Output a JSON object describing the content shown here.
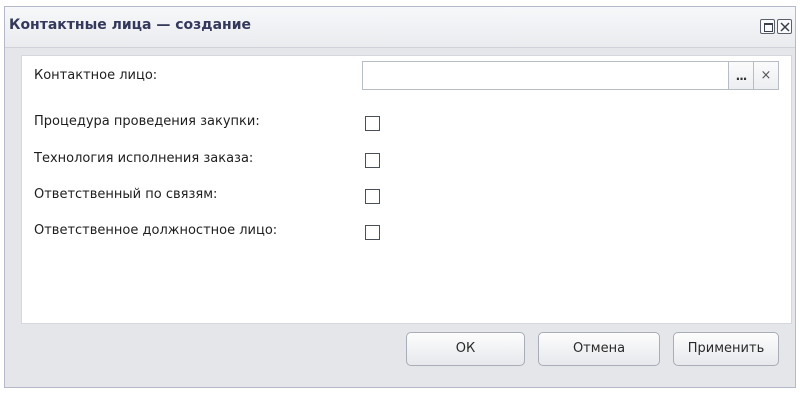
{
  "window": {
    "title": "Контактные лица — создание",
    "buttons": {
      "maximize_icon": "maximize-icon",
      "close_icon": "close-icon"
    }
  },
  "form": {
    "contact_person": {
      "label": "Контактное лицо:",
      "value": "",
      "placeholder": "",
      "select_button": "...",
      "clear_button": "×"
    },
    "checkboxes": [
      {
        "label": "Процедура проведения закупки:",
        "checked": false
      },
      {
        "label": "Технология исполнения заказа:",
        "checked": false
      },
      {
        "label": "Ответственный по связям:",
        "checked": false
      },
      {
        "label": "Ответственное должностное лицо:",
        "checked": false
      }
    ]
  },
  "footer": {
    "ok_label": "ОК",
    "cancel_label": "Отмена",
    "apply_label": "Применить"
  }
}
